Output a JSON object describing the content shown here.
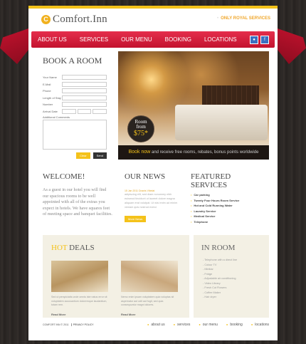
{
  "brand": {
    "logo_mark": "C",
    "name": "Comfort.Inn",
    "tagline_prefix": "•",
    "tagline": "ONLY ROYAL SERVICES"
  },
  "nav": {
    "items": [
      "ABOUT US",
      "SERVICES",
      "OUR MENU",
      "BOOKING",
      "LOCATIONS"
    ],
    "icons": [
      "flickr-icon",
      "facebook-icon"
    ]
  },
  "book": {
    "title": "BOOK A ROOM",
    "fields": [
      "Your Name",
      "E-Mail",
      "Phone",
      "Length of Stay",
      "Number",
      "Arrival Date"
    ],
    "comments_label": "Additional Comments",
    "clear": "Clear",
    "send": "Send"
  },
  "hero": {
    "price_line1": "Room",
    "price_line2": "from",
    "price_value": "$75*",
    "caption_highlight": "Book now",
    "caption_rest": "and receive free rooms, rebates, bonus points worldwide"
  },
  "welcome": {
    "title": "WELCOME!",
    "text": "As a guest in our hotel you will find our spacious rooms to be well appointed with all of the extras you expect in hotels. We have squares feet of meeting space and banquet facilities."
  },
  "news": {
    "title": "OUR NEWS",
    "date": "15 Jan 2011 Dosnis Vibelat",
    "text": "adipiscing elit, sed diam nonummy nibh euismod tincidunt ut laoreet dolore magna aliquam erat volutpat. Ut wisi enim ad minim veniam quis nostrud exerci",
    "more": "More News"
  },
  "services": {
    "title_line1": "FEATURED",
    "title_line2": "SERVICES",
    "items": [
      "Car parking",
      "Twenty Four Hours Room Service",
      "Hot and Cold Running Water",
      "Laundry Service",
      "Medical Service",
      "Telephone"
    ]
  },
  "deals": {
    "title_hot": "HOT",
    "title_rest": "DEALS",
    "items": [
      {
        "text": "Sed ut perspiciatis unde omnis iste natus error sit voluptatem accusantium doloremque laudantium, totam rem.",
        "more": "Read More"
      },
      {
        "text": "Nemo enim ipsam voluptatem quia voluptas sit aspernatur aut odit aut fugit, sed quia consequuntur magni dolores.",
        "more": "Read More"
      }
    ]
  },
  "inroom": {
    "title": "IN ROOM",
    "items": [
      "Telephone with a direct line",
      "Colour TV",
      "Minibar",
      "Fridge",
      "Adjustable air conditioning",
      "Video Library",
      "Fresh Cut Flowers",
      "Coffee Maker",
      "Hair dryer"
    ]
  },
  "footer": {
    "copyright": "COMFORT INN © 2011",
    "privacy": "PRIVACY POLICY",
    "nav": [
      "about us",
      "services",
      "our menu",
      "booking",
      "locations"
    ]
  }
}
